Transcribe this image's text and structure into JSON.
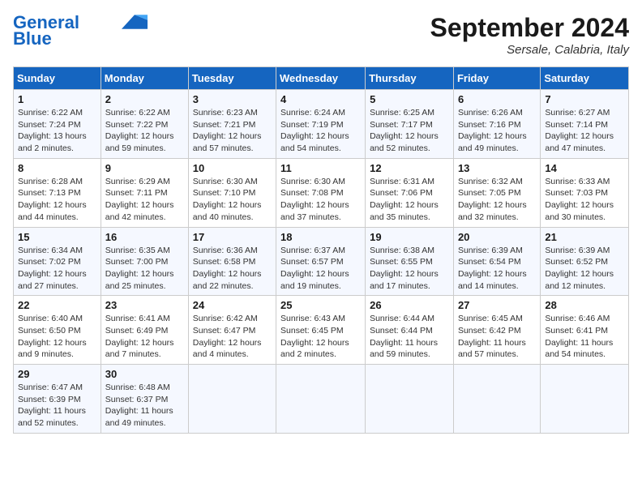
{
  "header": {
    "logo_line1": "General",
    "logo_line2": "Blue",
    "month_title": "September 2024",
    "location": "Sersale, Calabria, Italy"
  },
  "days_of_week": [
    "Sunday",
    "Monday",
    "Tuesday",
    "Wednesday",
    "Thursday",
    "Friday",
    "Saturday"
  ],
  "weeks": [
    [
      {
        "day": 1,
        "sunrise": "6:22 AM",
        "sunset": "7:24 PM",
        "daylight": "13 hours and 2 minutes."
      },
      {
        "day": 2,
        "sunrise": "6:22 AM",
        "sunset": "7:22 PM",
        "daylight": "12 hours and 59 minutes."
      },
      {
        "day": 3,
        "sunrise": "6:23 AM",
        "sunset": "7:21 PM",
        "daylight": "12 hours and 57 minutes."
      },
      {
        "day": 4,
        "sunrise": "6:24 AM",
        "sunset": "7:19 PM",
        "daylight": "12 hours and 54 minutes."
      },
      {
        "day": 5,
        "sunrise": "6:25 AM",
        "sunset": "7:17 PM",
        "daylight": "12 hours and 52 minutes."
      },
      {
        "day": 6,
        "sunrise": "6:26 AM",
        "sunset": "7:16 PM",
        "daylight": "12 hours and 49 minutes."
      },
      {
        "day": 7,
        "sunrise": "6:27 AM",
        "sunset": "7:14 PM",
        "daylight": "12 hours and 47 minutes."
      }
    ],
    [
      {
        "day": 8,
        "sunrise": "6:28 AM",
        "sunset": "7:13 PM",
        "daylight": "12 hours and 44 minutes."
      },
      {
        "day": 9,
        "sunrise": "6:29 AM",
        "sunset": "7:11 PM",
        "daylight": "12 hours and 42 minutes."
      },
      {
        "day": 10,
        "sunrise": "6:30 AM",
        "sunset": "7:10 PM",
        "daylight": "12 hours and 40 minutes."
      },
      {
        "day": 11,
        "sunrise": "6:30 AM",
        "sunset": "7:08 PM",
        "daylight": "12 hours and 37 minutes."
      },
      {
        "day": 12,
        "sunrise": "6:31 AM",
        "sunset": "7:06 PM",
        "daylight": "12 hours and 35 minutes."
      },
      {
        "day": 13,
        "sunrise": "6:32 AM",
        "sunset": "7:05 PM",
        "daylight": "12 hours and 32 minutes."
      },
      {
        "day": 14,
        "sunrise": "6:33 AM",
        "sunset": "7:03 PM",
        "daylight": "12 hours and 30 minutes."
      }
    ],
    [
      {
        "day": 15,
        "sunrise": "6:34 AM",
        "sunset": "7:02 PM",
        "daylight": "12 hours and 27 minutes."
      },
      {
        "day": 16,
        "sunrise": "6:35 AM",
        "sunset": "7:00 PM",
        "daylight": "12 hours and 25 minutes."
      },
      {
        "day": 17,
        "sunrise": "6:36 AM",
        "sunset": "6:58 PM",
        "daylight": "12 hours and 22 minutes."
      },
      {
        "day": 18,
        "sunrise": "6:37 AM",
        "sunset": "6:57 PM",
        "daylight": "12 hours and 19 minutes."
      },
      {
        "day": 19,
        "sunrise": "6:38 AM",
        "sunset": "6:55 PM",
        "daylight": "12 hours and 17 minutes."
      },
      {
        "day": 20,
        "sunrise": "6:39 AM",
        "sunset": "6:54 PM",
        "daylight": "12 hours and 14 minutes."
      },
      {
        "day": 21,
        "sunrise": "6:39 AM",
        "sunset": "6:52 PM",
        "daylight": "12 hours and 12 minutes."
      }
    ],
    [
      {
        "day": 22,
        "sunrise": "6:40 AM",
        "sunset": "6:50 PM",
        "daylight": "12 hours and 9 minutes."
      },
      {
        "day": 23,
        "sunrise": "6:41 AM",
        "sunset": "6:49 PM",
        "daylight": "12 hours and 7 minutes."
      },
      {
        "day": 24,
        "sunrise": "6:42 AM",
        "sunset": "6:47 PM",
        "daylight": "12 hours and 4 minutes."
      },
      {
        "day": 25,
        "sunrise": "6:43 AM",
        "sunset": "6:45 PM",
        "daylight": "12 hours and 2 minutes."
      },
      {
        "day": 26,
        "sunrise": "6:44 AM",
        "sunset": "6:44 PM",
        "daylight": "11 hours and 59 minutes."
      },
      {
        "day": 27,
        "sunrise": "6:45 AM",
        "sunset": "6:42 PM",
        "daylight": "11 hours and 57 minutes."
      },
      {
        "day": 28,
        "sunrise": "6:46 AM",
        "sunset": "6:41 PM",
        "daylight": "11 hours and 54 minutes."
      }
    ],
    [
      {
        "day": 29,
        "sunrise": "6:47 AM",
        "sunset": "6:39 PM",
        "daylight": "11 hours and 52 minutes."
      },
      {
        "day": 30,
        "sunrise": "6:48 AM",
        "sunset": "6:37 PM",
        "daylight": "11 hours and 49 minutes."
      },
      null,
      null,
      null,
      null,
      null
    ]
  ]
}
